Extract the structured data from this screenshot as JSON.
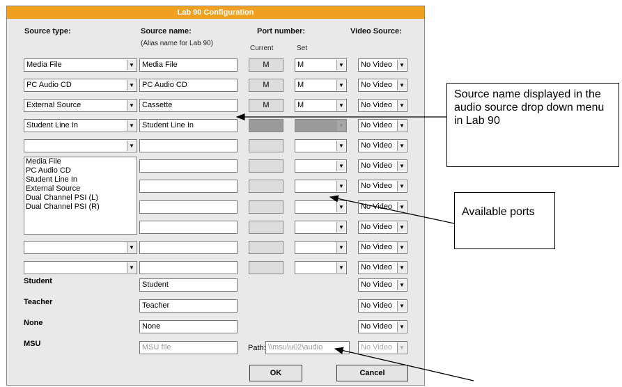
{
  "window": {
    "title": "Lab 90 Configuration"
  },
  "headers": {
    "source_type": "Source type:",
    "source_name": "Source name:",
    "alias_hint": "(Alias name for Lab 90)",
    "port_number": "Port number:",
    "current": "Current",
    "set": "Set",
    "video_source": "Video Source:"
  },
  "rows": [
    {
      "type": "Media File",
      "name": "Media File",
      "current": "M",
      "set": "M",
      "video": "No Video"
    },
    {
      "type": "PC Audio CD",
      "name": "PC Audio CD",
      "current": "M",
      "set": "M",
      "video": "No Video"
    },
    {
      "type": "External Source",
      "name": "Cassette",
      "current": "M",
      "set": "M",
      "video": "No Video"
    },
    {
      "type": "Student Line In",
      "name": "Student Line In",
      "current": "",
      "set": "",
      "video": "No Video"
    },
    {
      "type": "",
      "name": "",
      "current": "",
      "set": "",
      "video": "No Video"
    },
    {
      "type": "",
      "name": "",
      "current": "",
      "set": "",
      "video": "No Video"
    },
    {
      "type": "",
      "name": "",
      "current": "",
      "set": "",
      "video": "No Video"
    },
    {
      "type": "",
      "name": "",
      "current": "",
      "set": "",
      "video": "No Video"
    },
    {
      "type": "",
      "name": "",
      "current": "",
      "set": "",
      "video": "No Video"
    },
    {
      "type": "",
      "name": "",
      "current": "",
      "set": "",
      "video": "No Video"
    },
    {
      "type": "",
      "name": "",
      "current": "",
      "set": "",
      "video": "No Video"
    }
  ],
  "dropdown_options": [
    "Media File",
    "PC Audio CD",
    "Student Line In",
    "External Source",
    "Dual Channel PSI (L)",
    "Dual Channel PSI (R)"
  ],
  "fixed_rows": [
    {
      "label": "Student",
      "name": "Student",
      "video": "No Video"
    },
    {
      "label": "Teacher",
      "name": "Teacher",
      "video": "No Video"
    },
    {
      "label": "None",
      "name": "None",
      "video": "No Video"
    },
    {
      "label": "MSU",
      "name": "MSU file",
      "video": "No Video"
    }
  ],
  "path": {
    "label": "Path:",
    "value": "\\\\msu\\u02\\audio"
  },
  "buttons": {
    "ok": "OK",
    "cancel": "Cancel"
  },
  "callouts": {
    "source_name": "Source name displayed in the audio source drop down menu in Lab 90",
    "ports": "Available ports"
  },
  "icons": {
    "dropdown_arrow": "▼"
  }
}
